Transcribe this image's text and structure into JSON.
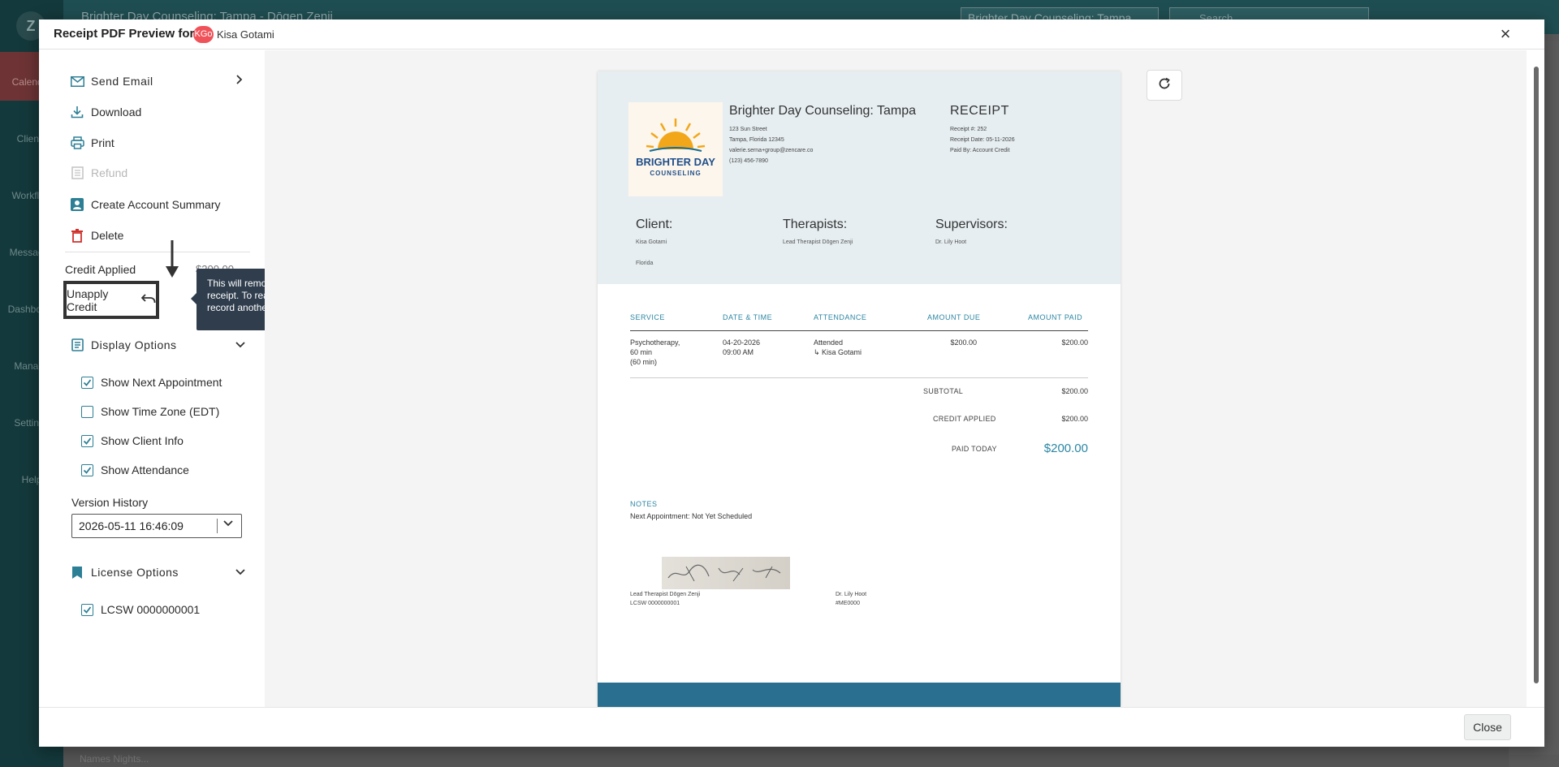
{
  "background": {
    "breadcrumb": "Brighter Day Counseling: Tampa - Dōgen Zenji",
    "location_select": "Brighter Day Counseling: Tampa",
    "search_placeholder": "Search",
    "logo_letter": "Z",
    "nav": [
      {
        "label": "Calendar",
        "icon": "calendar-icon"
      },
      {
        "label": "Clients",
        "icon": "clients-icon"
      },
      {
        "label": "Workflow",
        "icon": "folder-icon"
      },
      {
        "label": "Messages",
        "icon": "message-icon"
      },
      {
        "label": "Dashboard",
        "icon": "chart-icon"
      },
      {
        "label": "Manage",
        "icon": "grid-icon"
      },
      {
        "label": "Settings",
        "icon": "gear-icon"
      },
      {
        "label": "Help",
        "icon": "help-icon"
      }
    ],
    "bottom_text": "Names Nights..."
  },
  "modal": {
    "title": "Receipt PDF Preview for",
    "client_initials": "KGo",
    "client_name": "Kisa Gotami",
    "close_label": "Close"
  },
  "actions": {
    "send_email": "Send Email",
    "download": "Download",
    "print": "Print",
    "refund": "Refund",
    "create_account_summary": "Create Account Summary",
    "delete": "Delete",
    "credit_applied_label": "Credit Applied",
    "credit_applied_value": "$200.00",
    "unapply_credit": "Unapply Credit",
    "tooltip": "This will remove all credit associated with this receipt. To reapply credit, you will have to record another payment"
  },
  "display_options": {
    "title": "Display Options",
    "items": [
      {
        "label": "Show Next Appointment",
        "checked": true
      },
      {
        "label": "Show Time Zone (EDT)",
        "checked": false
      },
      {
        "label": "Show Client Info",
        "checked": true
      },
      {
        "label": "Show Attendance",
        "checked": true
      }
    ]
  },
  "version_history": {
    "label": "Version History",
    "selected": "2026-05-11 16:46:09"
  },
  "license_options": {
    "title": "License Options",
    "items": [
      {
        "label": "LCSW 0000000001",
        "checked": true
      }
    ]
  },
  "receipt": {
    "business_name": "Brighter Day Counseling: Tampa",
    "logo_text_line1": "BRIGHTER DAY",
    "logo_text_line2": "COUNSELING",
    "address1": "123 Sun Street",
    "address2": "Tampa, Florida 12345",
    "email": "valerie.serna+group@zencare.co",
    "phone": "(123) 456-7890",
    "title": "RECEIPT",
    "receipt_no": "Receipt #: 252",
    "receipt_date": "Receipt Date: 05-11-2026",
    "paid_by": "Paid By: Account Credit",
    "client_head": "Client:",
    "client_name": "Kisa Gotami",
    "client_state": "Florida",
    "therapists_head": "Therapists:",
    "therapist": "Lead Therapist Dōgen Zenji",
    "supervisors_head": "Supervisors:",
    "supervisor": "Dr. Lily Hoot",
    "table_headers": [
      "SERVICE",
      "DATE & TIME",
      "ATTENDANCE",
      "AMOUNT DUE",
      "AMOUNT PAID"
    ],
    "row": {
      "service_1": "Psychotherapy,",
      "service_2": "60 min",
      "service_3": "(60 min)",
      "date": "04-20-2026",
      "time": "09:00 AM",
      "attendance": "Attended",
      "attendee": "↳ Kisa Gotami",
      "amount_due": "$200.00",
      "amount_paid": "$200.00"
    },
    "subtotal_label": "SUBTOTAL",
    "subtotal": "$200.00",
    "credit_label": "CREDIT APPLIED",
    "credit": "$200.00",
    "paid_today_label": "PAID TODAY",
    "paid_today": "$200.00",
    "notes_head": "NOTES",
    "notes_text": "Next Appointment: Not Yet Scheduled",
    "sig_left_1": "Lead Therapist Dōgen Zenji",
    "sig_left_2": "LCSW 0000000001",
    "sig_right_1": "Dr. Lily Hoot",
    "sig_right_2": "#ME0000"
  },
  "colors": {
    "accent": "#2c86a3",
    "tooltip_bg": "#2f3d4d",
    "receipt_header_bg": "#e6eef1",
    "receipt_footer": "#2a6f8f",
    "delete_red": "#d0312d",
    "avatar": "#f0525a"
  }
}
